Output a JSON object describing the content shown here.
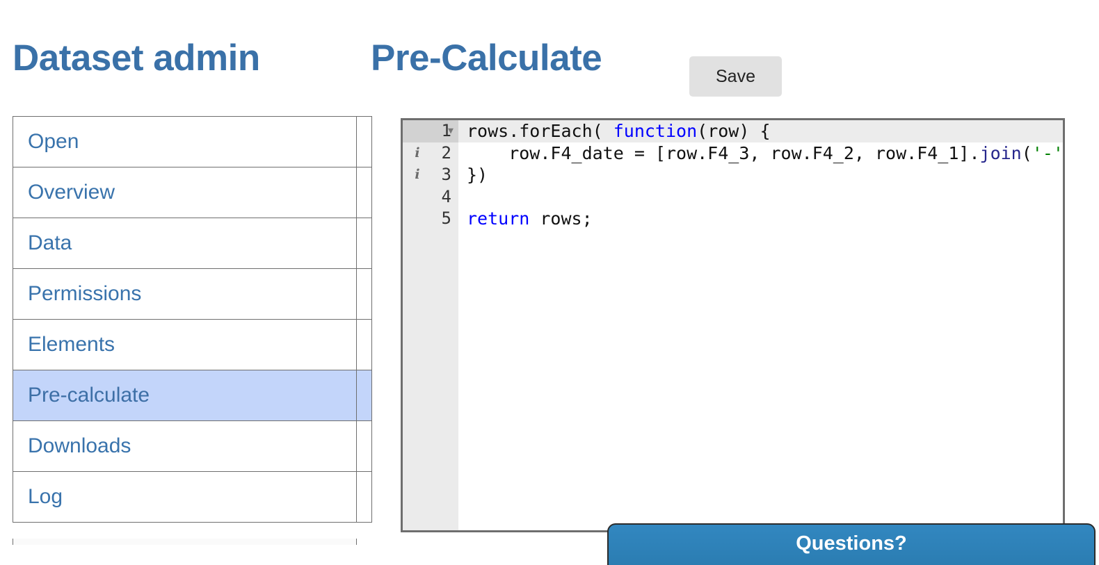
{
  "header": {
    "page_title": "Dataset admin",
    "section_title": "Pre-Calculate",
    "save_label": "Save"
  },
  "sidebar": {
    "items": [
      {
        "label": "Open",
        "active": false
      },
      {
        "label": "Overview",
        "active": false
      },
      {
        "label": "Data",
        "active": false
      },
      {
        "label": "Permissions",
        "active": false
      },
      {
        "label": "Elements",
        "active": false
      },
      {
        "label": "Pre-calculate",
        "active": true
      },
      {
        "label": "Downloads",
        "active": false
      },
      {
        "label": "Log",
        "active": false
      }
    ]
  },
  "editor": {
    "active_line": 1,
    "fold_arrow_glyph": "▼",
    "info_marker_glyph": "i",
    "lines": [
      {
        "number": "1",
        "marker": "fold",
        "tokens": [
          {
            "text": "rows.forEach( ",
            "type": "plain"
          },
          {
            "text": "function",
            "type": "kw"
          },
          {
            "text": "(row) {",
            "type": "plain"
          }
        ]
      },
      {
        "number": "2",
        "marker": "info",
        "tokens": [
          {
            "text": "    row.F4_date = [row.F4_3, row.F4_2, row.F4_1].",
            "type": "plain"
          },
          {
            "text": "join",
            "type": "fn"
          },
          {
            "text": "(",
            "type": "plain"
          },
          {
            "text": "'-'",
            "type": "str"
          },
          {
            "text": ")",
            "type": "plain"
          }
        ]
      },
      {
        "number": "3",
        "marker": "info",
        "tokens": [
          {
            "text": "})",
            "type": "plain"
          }
        ]
      },
      {
        "number": "4",
        "marker": "none",
        "tokens": [
          {
            "text": "",
            "type": "plain"
          }
        ]
      },
      {
        "number": "5",
        "marker": "none",
        "tokens": [
          {
            "text": "return",
            "type": "kw"
          },
          {
            "text": " rows;",
            "type": "plain"
          }
        ]
      }
    ]
  },
  "support_widget": {
    "label": "Questions?",
    "color": "#3287c0"
  }
}
